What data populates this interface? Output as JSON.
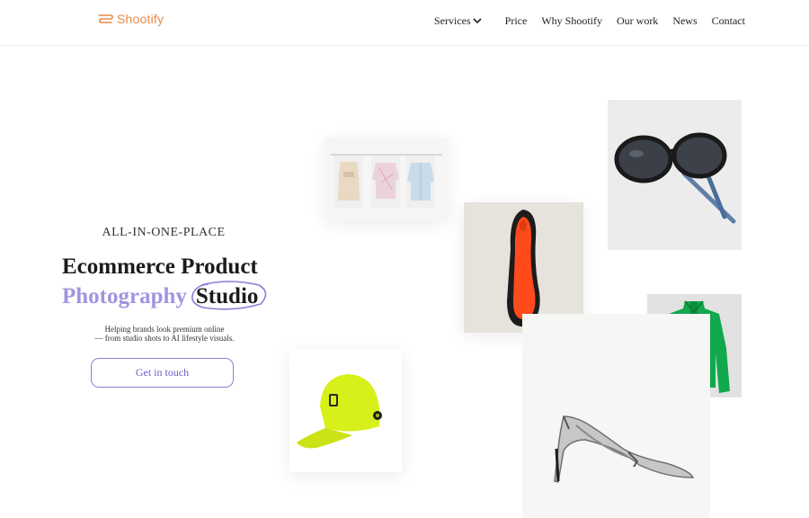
{
  "header": {
    "logo_text": "Shootify",
    "nav": [
      {
        "label": "Services",
        "has_dropdown": true
      },
      {
        "label": "Price"
      },
      {
        "label": "Why Shootify"
      },
      {
        "label": "Our work"
      },
      {
        "label": "News"
      },
      {
        "label": "Contact"
      }
    ]
  },
  "hero": {
    "eyebrow": "ALL-IN-ONE-PLACE",
    "headline_line1": "Ecommerce Product",
    "headline_accent": "Photography",
    "headline_circled": "Studio",
    "subtext_line1": "Helping brands look premium online",
    "subtext_line2": "— from studio shots to AI lifestyle visuals.",
    "cta_label": "Get in touch"
  },
  "colors": {
    "brand_orange": "#e8894a",
    "accent_purple": "#a195e0",
    "cta_border": "#8b7fd6"
  },
  "gallery": [
    {
      "name": "clothing-rack-photo"
    },
    {
      "name": "sunglasses-photo"
    },
    {
      "name": "shoe-sole-photo"
    },
    {
      "name": "green-jacket-photo"
    },
    {
      "name": "green-cap-photo"
    },
    {
      "name": "silver-heel-photo"
    }
  ]
}
